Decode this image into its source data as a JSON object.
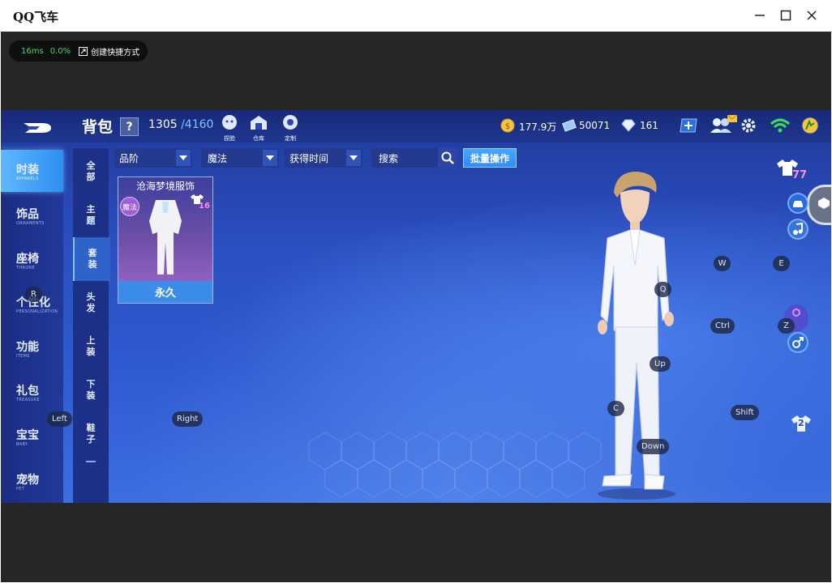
{
  "window": {
    "title": "QQ飞车"
  },
  "status_bar": {
    "ping": "16ms",
    "loss": "0.0%",
    "shortcut_label": "创建快捷方式"
  },
  "header": {
    "title": "背包",
    "help": "?",
    "capacity_used": "1305",
    "capacity_total": "/4160",
    "tools": [
      {
        "label": "捏脸",
        "icon": "face-edit-icon"
      },
      {
        "label": "仓库",
        "icon": "warehouse-icon"
      },
      {
        "label": "定制",
        "icon": "customize-icon"
      }
    ],
    "coins": "177.9万",
    "vouchers": "50071",
    "diamonds": "161"
  },
  "left_nav": [
    {
      "label": "时装",
      "sub": "APPARELS",
      "active": true
    },
    {
      "label": "饰品",
      "sub": "ORNAMENTS",
      "active": false
    },
    {
      "label": "座椅",
      "sub": "THRONE",
      "active": false
    },
    {
      "label": "个性化",
      "sub": "PERSONALIZATION",
      "active": false
    },
    {
      "label": "功能",
      "sub": "ITEMS",
      "active": false
    },
    {
      "label": "礼包",
      "sub": "TREASURE",
      "active": false
    },
    {
      "label": "宝宝",
      "sub": "BABY",
      "active": false
    },
    {
      "label": "宠物",
      "sub": "PET",
      "active": false
    }
  ],
  "sub_nav": [
    {
      "label": "全部",
      "active": false
    },
    {
      "label": "主题",
      "active": false
    },
    {
      "label": "套装",
      "active": true
    },
    {
      "label": "头发",
      "active": false
    },
    {
      "label": "上装",
      "active": false
    },
    {
      "label": "下装",
      "active": false
    },
    {
      "label": "鞋子",
      "active": false
    }
  ],
  "filters": {
    "grade": "品阶",
    "type": "魔法",
    "sort": "获得时间",
    "search_placeholder": "搜索",
    "batch": "批量操作"
  },
  "item": {
    "name": "沧海梦境服饰",
    "tag": "魔法",
    "level": "16",
    "duration": "永久"
  },
  "wardrobe_count": "77",
  "slot_badge": "2",
  "key_hints": {
    "r": "R",
    "left": "Left",
    "right": "Right",
    "q": "Q",
    "w": "W",
    "e": "E",
    "ctrl": "Ctrl",
    "z": "Z",
    "up": "Up",
    "c": "C",
    "shift": "Shift",
    "down": "Down"
  },
  "colors": {
    "accent": "#2e8ff0",
    "capacity_total": "#7ec8ff",
    "ping": "#4cd964",
    "batch_button": "#2f8cff",
    "card_purple": "#6f4fa8"
  }
}
